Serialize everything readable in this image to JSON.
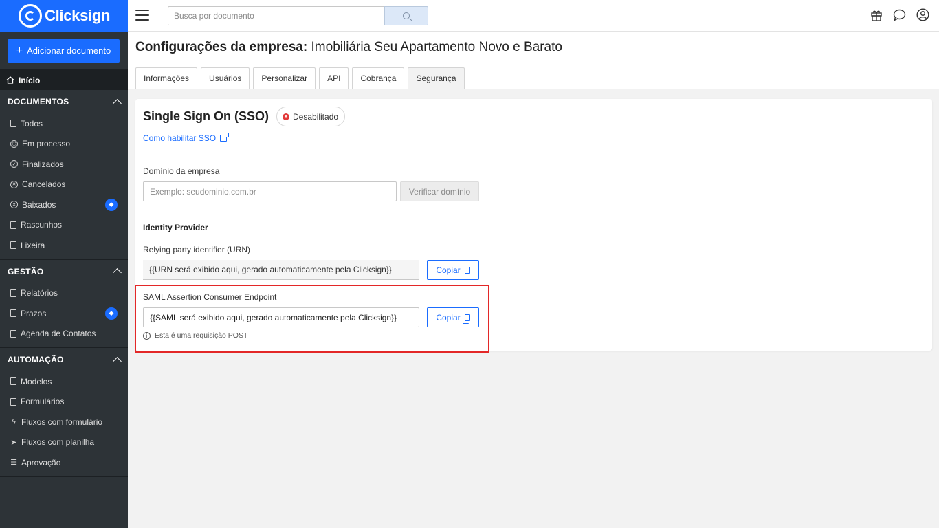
{
  "brand": {
    "name": "Clicksign",
    "accent": "#1a6cff",
    "sidebar_bg": "#2d3337"
  },
  "sidebar": {
    "add_button": "Adicionar documento",
    "home": "Início",
    "sections": [
      {
        "title": "DOCUMENTOS",
        "items": [
          {
            "label": "Todos",
            "icon": "copy-icon"
          },
          {
            "label": "Em processo",
            "icon": "clock-icon"
          },
          {
            "label": "Finalizados",
            "icon": "check-circle-icon"
          },
          {
            "label": "Cancelados",
            "icon": "x-circle-icon"
          },
          {
            "label": "Baixados",
            "icon": "x-circle-icon",
            "premium": true
          },
          {
            "label": "Rascunhos",
            "icon": "draft-icon"
          },
          {
            "label": "Lixeira",
            "icon": "trash-icon"
          }
        ]
      },
      {
        "title": "GESTÃO",
        "items": [
          {
            "label": "Relatórios",
            "icon": "table-icon"
          },
          {
            "label": "Prazos",
            "icon": "calendar-icon",
            "premium": true
          },
          {
            "label": "Agenda de Contatos",
            "icon": "contacts-icon"
          }
        ]
      },
      {
        "title": "AUTOMAÇÃO",
        "items": [
          {
            "label": "Modelos",
            "icon": "template-icon"
          },
          {
            "label": "Formulários",
            "icon": "clipboard-icon"
          },
          {
            "label": "Fluxos com formulário",
            "icon": "bolt-icon"
          },
          {
            "label": "Fluxos com planilha",
            "icon": "send-icon"
          },
          {
            "label": "Aprovação",
            "icon": "checklist-icon"
          }
        ]
      }
    ]
  },
  "topbar": {
    "search_placeholder": "Busca por documento"
  },
  "header": {
    "title_prefix": "Configurações da empresa:",
    "company_name": "Imobiliária Seu Apartamento Novo e Barato",
    "tabs": [
      "Informações",
      "Usuários",
      "Personalizar",
      "API",
      "Cobrança",
      "Segurança"
    ],
    "active_tab": "Segurança"
  },
  "sso": {
    "title": "Single Sign On (SSO)",
    "status": "Desabilitado",
    "help_link": "Como habilitar SSO",
    "domain_label": "Domínio da empresa",
    "domain_placeholder": "Exemplo: seudominio.com.br",
    "verify_button": "Verificar domínio",
    "idp_heading": "Identity Provider",
    "urn_label": "Relying party identifier (URN)",
    "urn_value": "{{URN será exibido aqui, gerado automaticamente pela Clicksign}}",
    "saml_label": "SAML Assertion Consumer Endpoint",
    "saml_value": "{{SAML será exibido aqui, gerado automaticamente pela Clicksign}}",
    "copy_button": "Copiar",
    "post_note": "Esta é uma requisição POST"
  }
}
